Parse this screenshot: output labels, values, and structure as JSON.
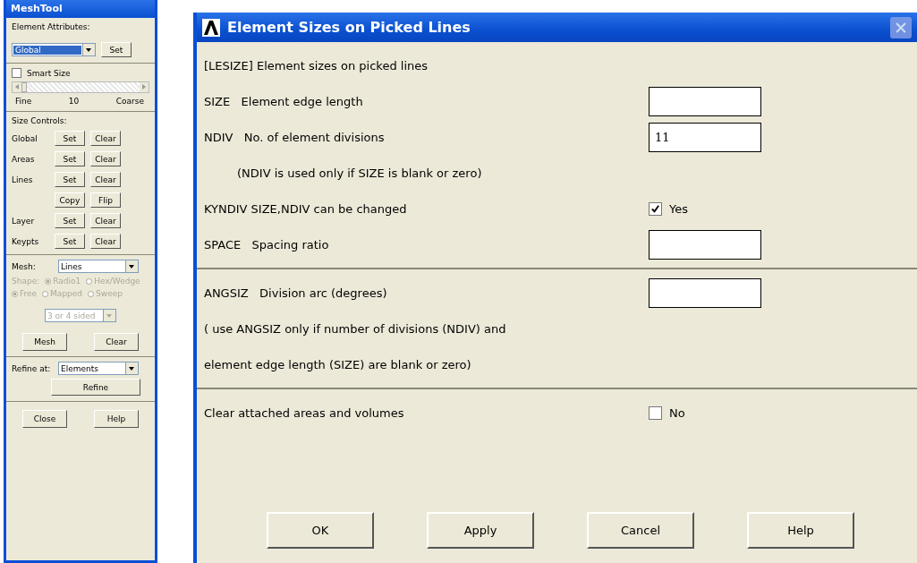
{
  "meshtool": {
    "title": "MeshTool",
    "element_attributes": {
      "label": "Element Attributes:",
      "value": "Global",
      "button": "Set"
    },
    "smart_size": {
      "label": "Smart Size",
      "checked": false,
      "level": 0.0,
      "fine": "Fine",
      "reading": "10",
      "coarse": "Coarse"
    },
    "size_controls": {
      "label": "Size Controls:",
      "rows": [
        {
          "label": "Global",
          "buttons": [
            "Set",
            "Clear"
          ]
        },
        {
          "label": "Areas",
          "buttons": [
            "Set",
            "Clear"
          ]
        },
        {
          "label": "Lines",
          "buttons": [
            "Set",
            "Clear"
          ]
        },
        {
          "buttons": [
            "Copy",
            "Flip"
          ]
        },
        {
          "label": "Layer",
          "buttons": [
            "Set",
            "Clear"
          ]
        },
        {
          "label": "Keypts",
          "buttons": [
            "Set",
            "Clear"
          ]
        }
      ]
    },
    "mesh": {
      "label": "Mesh:",
      "value": "Lines",
      "shape_label": "Shape:",
      "shape_options": [
        {
          "label": "Radio1",
          "selected": true
        },
        {
          "label": "Hex/Wedge",
          "selected": false
        }
      ],
      "method_options": [
        {
          "label": "Free",
          "selected": true
        },
        {
          "label": "Mapped",
          "selected": false
        },
        {
          "label": "Sweep",
          "selected": false
        }
      ],
      "disabled": true,
      "sides": "3 or 4 sided",
      "buttons": [
        "Mesh",
        "Clear"
      ]
    },
    "refine": {
      "label": "Refine at:",
      "value": "Elements",
      "button": "Refine"
    },
    "buttons": [
      "Close",
      "Help"
    ]
  },
  "dialog": {
    "title": "Element Sizes on Picked Lines",
    "sections": [
      [
        {
          "kind": "heading",
          "text": "[LESIZE]  Element sizes on picked lines"
        },
        {
          "kind": "field",
          "code": "SIZE",
          "text": "Element edge length"
        },
        {
          "kind": "field",
          "code": "NDIV",
          "text": "No. of element divisions",
          "value": "11"
        },
        {
          "kind": "note",
          "text": "(NDIV is used only if SIZE is blank or zero)"
        },
        {
          "kind": "checkbox",
          "code": "KYNDIV",
          "text": "SIZE,NDIV can be changed",
          "checked": true,
          "label": "Yes"
        },
        {
          "kind": "field",
          "code": "SPACE",
          "text": "Spacing ratio"
        }
      ],
      [
        {
          "kind": "field",
          "code": "ANGSIZ",
          "text": "Division arc (degrees)"
        },
        {
          "kind": "heading",
          "text": "( use ANGSIZ only if number of divisions (NDIV) and"
        },
        {
          "kind": "heading",
          "text": "element edge length (SIZE) are blank or zero)"
        }
      ],
      [
        {
          "kind": "checkbox",
          "text": "Clear attached areas and volumes",
          "checked": false,
          "label": "No"
        }
      ]
    ],
    "buttons": [
      "OK",
      "Apply",
      "Cancel",
      "Help"
    ]
  }
}
